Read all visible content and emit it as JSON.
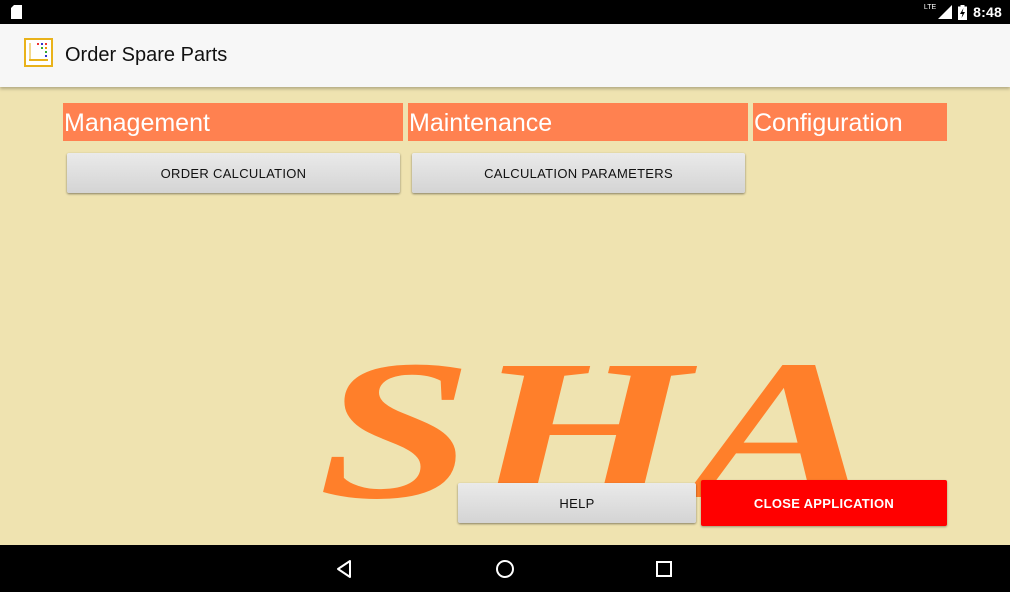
{
  "status_bar": {
    "time": "8:48",
    "network": "LTE",
    "icons": [
      "sd-card-icon",
      "signal-icon",
      "battery-charging-icon"
    ]
  },
  "app_bar": {
    "title": "Order Spare Parts",
    "icon": "app-logo-icon"
  },
  "sections": [
    {
      "label": "Management"
    },
    {
      "label": "Maintenance"
    },
    {
      "label": "Configuration"
    }
  ],
  "buttons": {
    "order_calculation": "ORDER CALCULATION",
    "calculation_parameters": "CALCULATION PARAMETERS",
    "help": "HELP",
    "close_application": "CLOSE APPLICATION"
  },
  "logo_text": "SHA",
  "colors": {
    "background": "#efe3b0",
    "section_header": "#ff8150",
    "logo": "#ff7f2a",
    "close_button": "#ff0000"
  },
  "nav_bar": {
    "icons": [
      "back-icon",
      "home-icon",
      "recents-icon"
    ]
  }
}
